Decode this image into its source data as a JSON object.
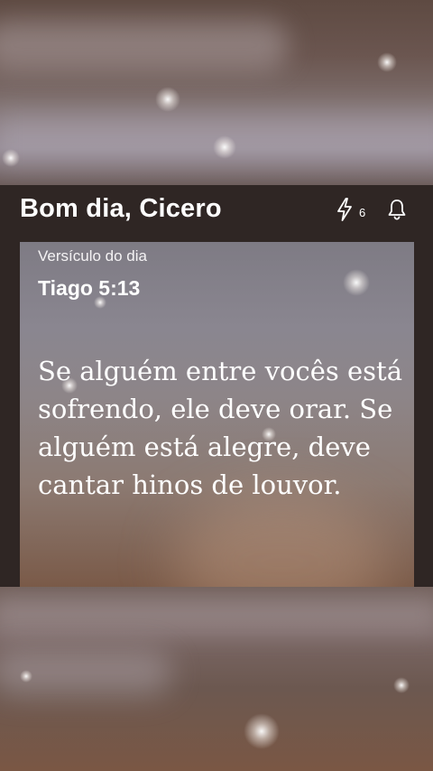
{
  "header": {
    "greeting": "Bom dia, Cicero",
    "streak_count": "6",
    "streak_icon": "lightning-icon",
    "bell_icon": "bell-icon"
  },
  "card": {
    "label": "Versículo do dia",
    "reference": "Tiago 5:13",
    "verse": "Se alguém entre vocês está sofrendo, ele deve orar. Se alguém está alegre, deve cantar hinos de louvor."
  },
  "colors": {
    "text": "#ffffff",
    "background": "#2f2624"
  }
}
